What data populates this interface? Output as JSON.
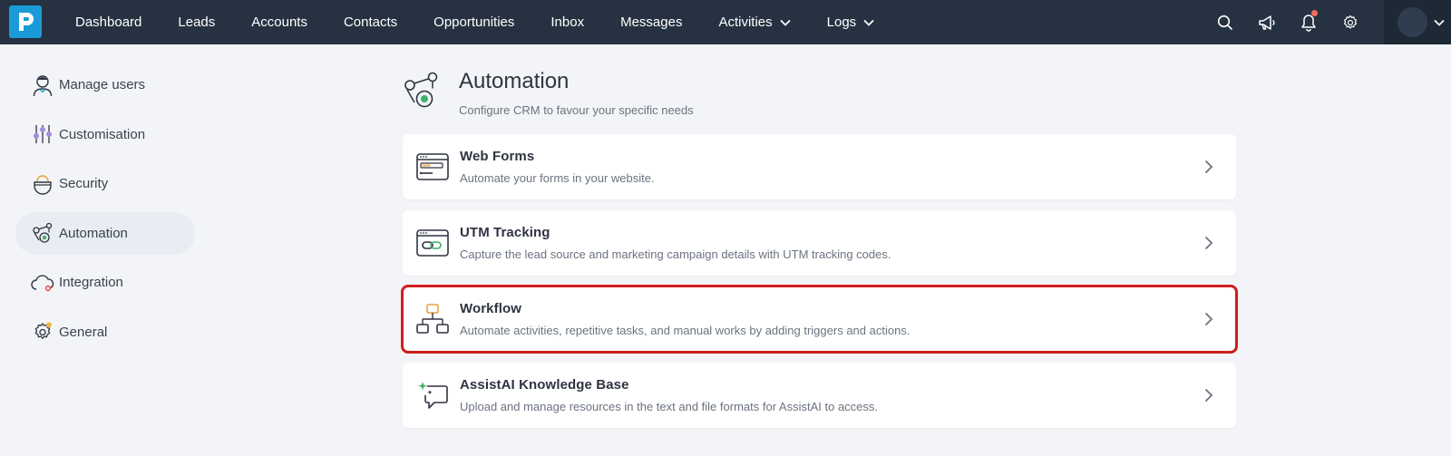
{
  "app": {
    "logo_icon": "pipeline-p-logo",
    "brand_color": "#1a9bd7",
    "nav_bg": "#263241"
  },
  "nav": {
    "items": [
      {
        "label": "Dashboard",
        "dropdown": false
      },
      {
        "label": "Leads",
        "dropdown": false
      },
      {
        "label": "Accounts",
        "dropdown": false
      },
      {
        "label": "Contacts",
        "dropdown": false
      },
      {
        "label": "Opportunities",
        "dropdown": false
      },
      {
        "label": "Inbox",
        "dropdown": false
      },
      {
        "label": "Messages",
        "dropdown": false
      },
      {
        "label": "Activities",
        "dropdown": true
      },
      {
        "label": "Logs",
        "dropdown": true
      }
    ],
    "icons": [
      "search-icon",
      "megaphone-icon",
      "bell-icon",
      "gear-icon"
    ],
    "notification_dot_color": "#f26b5b"
  },
  "sidebar": {
    "items": [
      {
        "label": "Manage users",
        "icon": "user-icon",
        "active": false
      },
      {
        "label": "Customisation",
        "icon": "sliders-icon",
        "active": false
      },
      {
        "label": "Security",
        "icon": "security-icon",
        "active": false
      },
      {
        "label": "Automation",
        "icon": "automation-icon",
        "active": true
      },
      {
        "label": "Integration",
        "icon": "cloud-icon",
        "active": false
      },
      {
        "label": "General",
        "icon": "gear-icon",
        "active": false
      }
    ]
  },
  "main": {
    "title": "Automation",
    "subtitle": "Configure CRM to favour your specific needs",
    "cards": [
      {
        "title": "Web Forms",
        "desc": "Automate your forms in your website.",
        "icon": "web-form-icon",
        "highlighted": false
      },
      {
        "title": "UTM Tracking",
        "desc": "Capture the lead source and marketing campaign details with UTM tracking codes.",
        "icon": "utm-link-icon",
        "highlighted": false
      },
      {
        "title": "Workflow",
        "desc": "Automate activities, repetitive tasks, and manual works by adding triggers and actions.",
        "icon": "workflow-icon",
        "highlighted": true
      },
      {
        "title": "AssistAI Knowledge Base",
        "desc": "Upload and manage resources in the text and file formats for AssistAI to access.",
        "icon": "ai-chat-icon",
        "highlighted": false
      }
    ],
    "highlight_color": "#d01e1e"
  }
}
